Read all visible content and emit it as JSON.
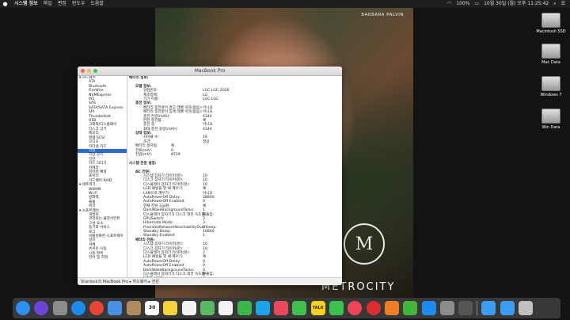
{
  "menubar": {
    "app_name": "시스템 정보",
    "items": [
      "파일",
      "편집",
      "윈도우",
      "도움말"
    ],
    "battery": "100%",
    "clock": "10월 30일 (월) 오후 11:25:42"
  },
  "wallpaper": {
    "brand": "BARBARA PALVIN",
    "logo": "METROCITY",
    "seal": "M"
  },
  "window": {
    "title": "MacBook Pro"
  },
  "sidebar": [
    {
      "label": "▾ 하드웨어",
      "type": "grp"
    },
    {
      "label": "ATA",
      "type": "it"
    },
    {
      "label": "Bluetooth",
      "type": "it"
    },
    {
      "label": "FireWire",
      "type": "it"
    },
    {
      "label": "NVMExpress",
      "type": "it"
    },
    {
      "label": "PCI",
      "type": "it"
    },
    {
      "label": "SAS",
      "type": "it"
    },
    {
      "label": "SATA/SATA Express",
      "type": "it"
    },
    {
      "label": "SPI",
      "type": "it"
    },
    {
      "label": "Thunderbolt",
      "type": "it"
    },
    {
      "label": "USB",
      "type": "it"
    },
    {
      "label": "그래픽/디스플레이",
      "type": "it"
    },
    {
      "label": "디스크 굽기",
      "type": "it"
    },
    {
      "label": "메모리",
      "type": "it"
    },
    {
      "label": "병렬 SCSI",
      "type": "it"
    },
    {
      "label": "오디오",
      "type": "it"
    },
    {
      "label": "이더넷 카드",
      "type": "it"
    },
    {
      "label": "전원",
      "type": "it",
      "selected": true
    },
    {
      "label": "저장 장치",
      "type": "it"
    },
    {
      "label": "진단",
      "type": "it"
    },
    {
      "label": "카드 리더기",
      "type": "it"
    },
    {
      "label": "카메라",
      "type": "it"
    },
    {
      "label": "파이버 채널",
      "type": "it"
    },
    {
      "label": "프린터",
      "type": "it"
    },
    {
      "label": "하드웨어 RAID",
      "type": "it"
    },
    {
      "label": "▾ 네트워크",
      "type": "grp"
    },
    {
      "label": "WWAN",
      "type": "it"
    },
    {
      "label": "Wi-Fi",
      "type": "it"
    },
    {
      "label": "방화벽",
      "type": "it"
    },
    {
      "label": "볼륨",
      "type": "it"
    },
    {
      "label": "위치",
      "type": "it"
    },
    {
      "label": "▾ 소프트웨어",
      "type": "grp"
    },
    {
      "label": "개발자",
      "type": "it"
    },
    {
      "label": "관리되는 클라이언트",
      "type": "it"
    },
    {
      "label": "구성 요소",
      "type": "it"
    },
    {
      "label": "동기화 서비스",
      "type": "it"
    },
    {
      "label": "로그",
      "type": "it"
    },
    {
      "label": "비활성화된 소프트웨어",
      "type": "it"
    },
    {
      "label": "설치",
      "type": "it"
    },
    {
      "label": "서체",
      "type": "it"
    },
    {
      "label": "손쉬운 사용",
      "type": "it"
    },
    {
      "label": "시동 항목",
      "type": "it"
    },
    {
      "label": "언어 및 지역",
      "type": "it"
    }
  ],
  "main": [
    {
      "k": "배터리 정보:",
      "v": "",
      "lvl": 0
    },
    {
      "k": "",
      "v": "",
      "lvl": 0
    },
    {
      "k": "모델 정보:",
      "v": "",
      "lvl": 1
    },
    {
      "k": "일련번호:",
      "v": "LGC LGC-2026",
      "lvl": 2
    },
    {
      "k": "제조업체:",
      "v": "LG",
      "lvl": 2
    },
    {
      "k": "기기 이름:",
      "v": "LGC-LGC",
      "lvl": 2
    },
    {
      "k": "충전 정보:",
      "v": "",
      "lvl": 1
    },
    {
      "k": "배터리 충전량이 경고 레벨 이하(없음):",
      "v": "아니요",
      "lvl": 2
    },
    {
      "k": "배터리 충전량이 임계 레벨 이하(없음):",
      "v": "아니요",
      "lvl": 2
    },
    {
      "k": "충전 잔량(mAh):",
      "v": "4344",
      "lvl": 2
    },
    {
      "k": "완전 충전됨:",
      "v": "예",
      "lvl": 2
    },
    {
      "k": "충전 중:",
      "v": "아니요",
      "lvl": 2
    },
    {
      "k": "최대 충전 용량(mAh):",
      "v": "4344",
      "lvl": 2
    },
    {
      "k": "상태 정보:",
      "v": "",
      "lvl": 1
    },
    {
      "k": "사이클 수:",
      "v": "19",
      "lvl": 2
    },
    {
      "k": "조건:",
      "v": "정상",
      "lvl": 2
    },
    {
      "k": "배터리 설치됨:",
      "v": "예",
      "lvl": 1
    },
    {
      "k": "전류(mA):",
      "v": "0",
      "lvl": 1
    },
    {
      "k": "전압(mV):",
      "v": "8729",
      "lvl": 1
    },
    {
      "k": "",
      "v": "",
      "lvl": 0
    },
    {
      "k": "시스템 전원 설정:",
      "v": "",
      "lvl": 0
    },
    {
      "k": "",
      "v": "",
      "lvl": 0
    },
    {
      "k": "AC 전원:",
      "v": "",
      "lvl": 1
    },
    {
      "k": "시스템 잠자기 타이머(분):",
      "v": "10",
      "lvl": 2
    },
    {
      "k": "디스크 잠자기 타이머(분):",
      "v": "10",
      "lvl": 2
    },
    {
      "k": "디스플레이 잠자기 타이머(분):",
      "v": "10",
      "lvl": 2
    },
    {
      "k": "LCD 패널을 열 때 깨우기:",
      "v": "예",
      "lvl": 2
    },
    {
      "k": "LAN으로 깨우기:",
      "v": "아니요",
      "lvl": 2
    },
    {
      "k": "AutoPowerOff Delay:",
      "v": "28800",
      "lvl": 2
    },
    {
      "k": "AutoPowerOff Enabled:",
      "v": "0",
      "lvl": 2
    },
    {
      "k": "현재 전원 공급원:",
      "v": "예",
      "lvl": 2
    },
    {
      "k": "DarkWakeBackgroundTasks:",
      "v": "1",
      "lvl": 2
    },
    {
      "k": "디스플레이 잠자기가 디스크 회전 속도를 줄임:",
      "v": "예",
      "lvl": 2
    },
    {
      "k": "GPUSwitch:",
      "v": "2",
      "lvl": 2
    },
    {
      "k": "Hibernate Mode:",
      "v": "3",
      "lvl": 2
    },
    {
      "k": "PrioritizeNetworkReachabilityOverSleep:",
      "v": "0",
      "lvl": 2
    },
    {
      "k": "Standby Delay:",
      "v": "10800",
      "lvl": 2
    },
    {
      "k": "Standby Enabled:",
      "v": "1",
      "lvl": 2
    },
    {
      "k": "배터리 전원:",
      "v": "",
      "lvl": 1
    },
    {
      "k": "시스템 잠자기 타이머(분):",
      "v": "10",
      "lvl": 2
    },
    {
      "k": "디스크 잠자기 타이머(분):",
      "v": "10",
      "lvl": 2
    },
    {
      "k": "디스플레이 잠자기 타이머(분):",
      "v": "2",
      "lvl": 2
    },
    {
      "k": "LCD 패널을 열 때 깨우기:",
      "v": "예",
      "lvl": 2
    },
    {
      "k": "AutoPowerOff Delay:",
      "v": "0",
      "lvl": 2
    },
    {
      "k": "AutoPowerOff Enabled:",
      "v": "0",
      "lvl": 2
    },
    {
      "k": "DarkWakeBackgroundTasks:",
      "v": "0",
      "lvl": 2
    },
    {
      "k": "디스플레이 잠자기가 디스크 회전 속도를 줄임:",
      "v": "예",
      "lvl": 2
    },
    {
      "k": "GPUSwitch:",
      "v": "2",
      "lvl": 2
    },
    {
      "k": "Hibernate Mode:",
      "v": "3",
      "lvl": 2
    },
    {
      "k": "밝기 감소:",
      "v": "예",
      "lvl": 2
    },
    {
      "k": "Standby Delay:",
      "v": "10800",
      "lvl": 2
    }
  ],
  "status": "Sherlock의 MacBook Pro ▸ 하드웨어 ▸ 전원",
  "desktop": [
    "Macintosh SSD",
    "Mac Data",
    "Windows 7",
    "Win Data"
  ],
  "dock": [
    "finder-icon",
    "siri-icon",
    "launchpad-icon",
    "safari-icon",
    "chrome-icon",
    "mail-icon",
    "contacts-icon",
    "calendar-icon",
    "notes-icon",
    "reminders-icon",
    "maps-icon",
    "photos-icon",
    "facetime-icon",
    "skype-icon",
    "camera-icon",
    "messages-icon",
    "kakaotalk-icon",
    "line-icon",
    "music-icon",
    "netease-icon",
    "app-icon",
    "wechat-icon",
    "appstore-icon",
    "system-prefs-icon",
    "keychain-icon",
    "folder-icon",
    "downloads-icon",
    "trash-icon"
  ],
  "calendar_day": "30",
  "talk_label": "TALK"
}
